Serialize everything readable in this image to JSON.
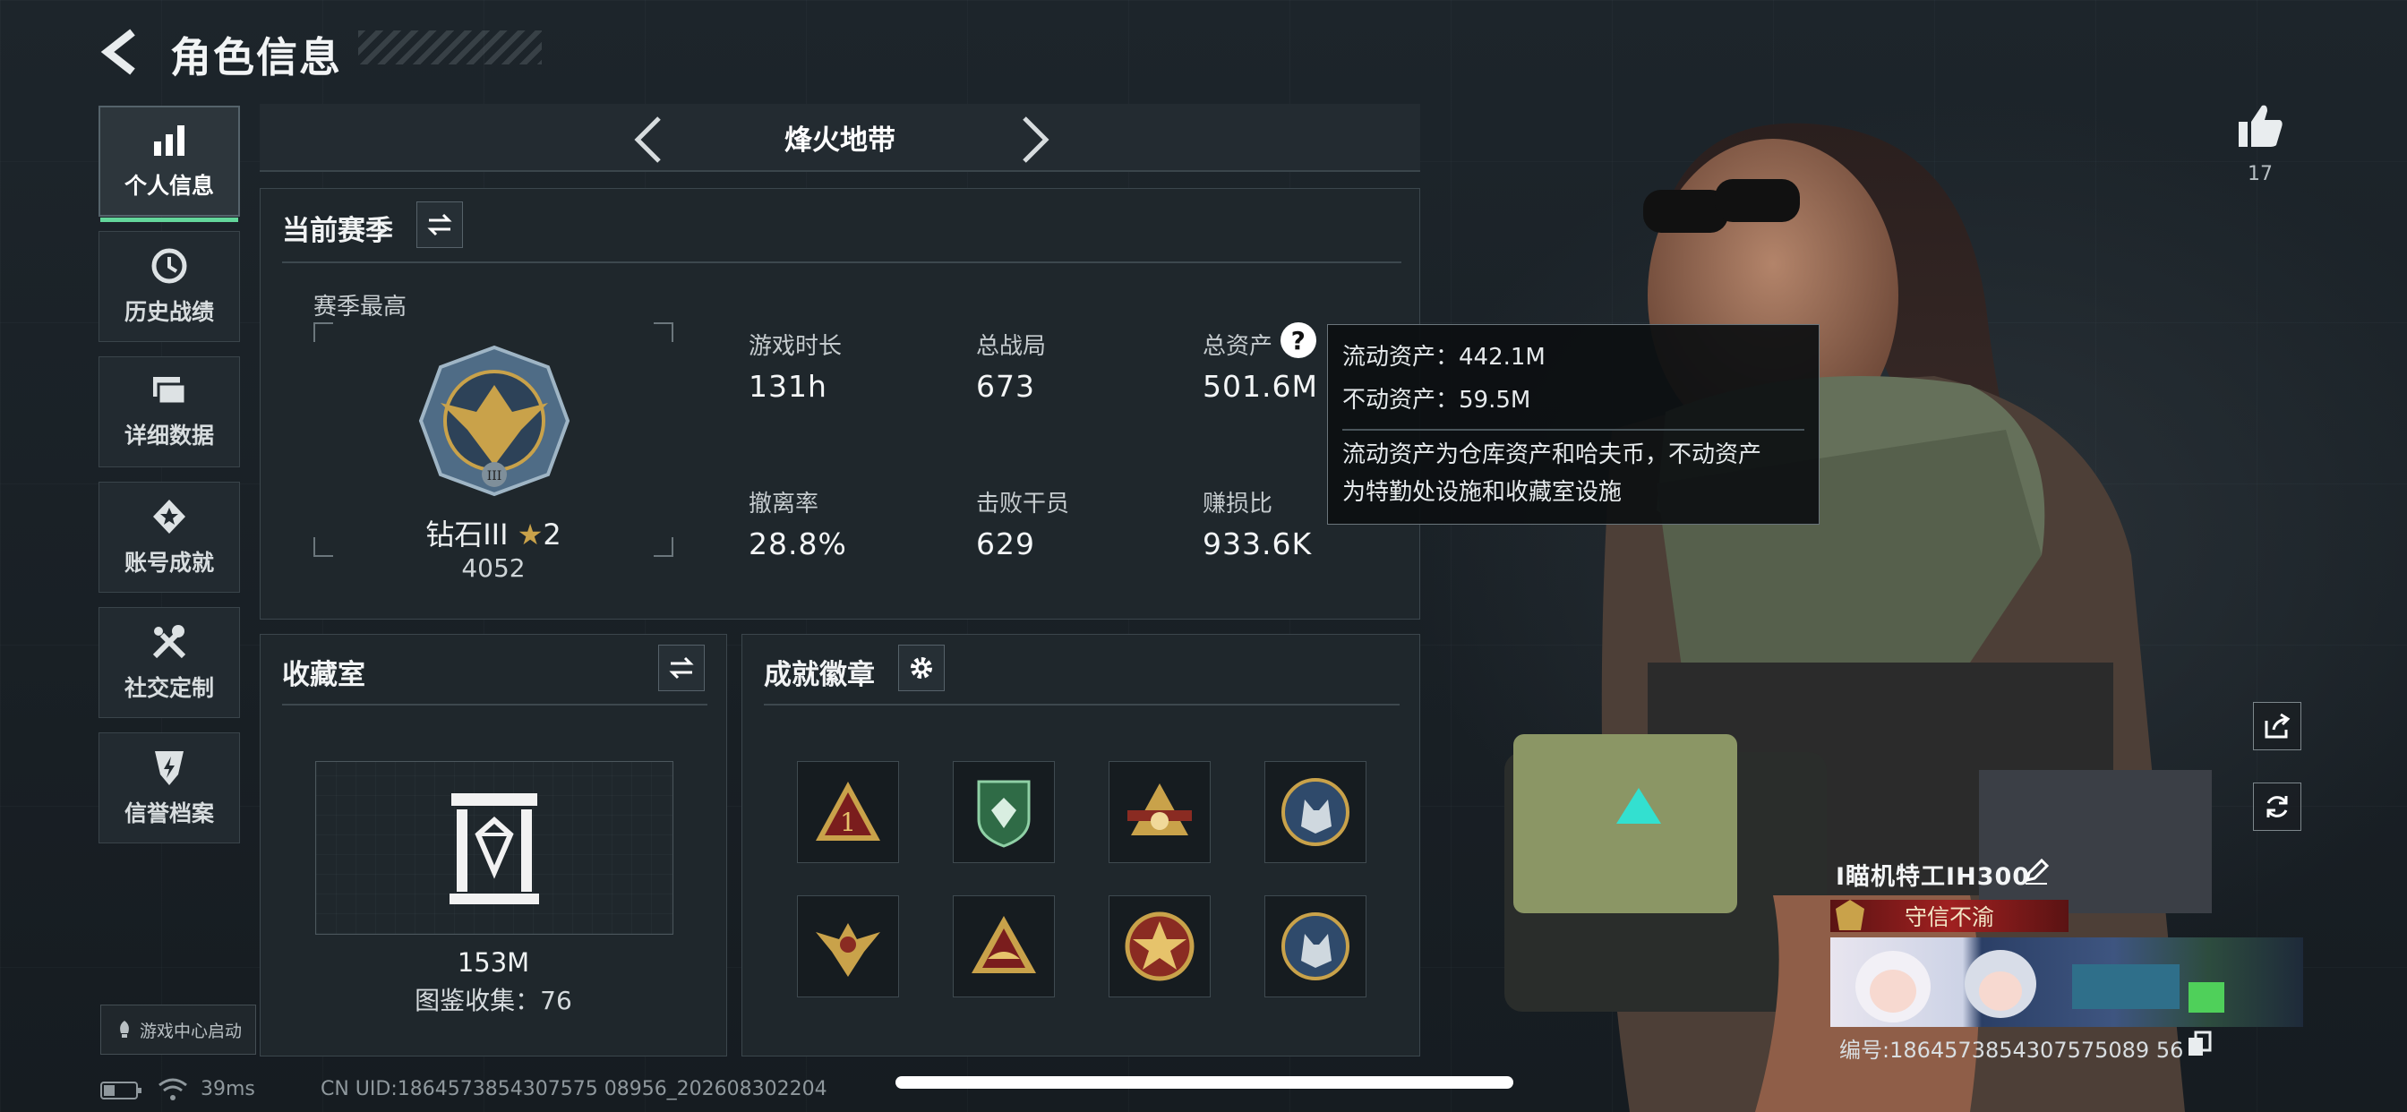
{
  "header": {
    "title": "角色信息"
  },
  "sidebar": {
    "items": [
      {
        "label": "个人信息",
        "icon": "bar-chart-icon",
        "active": true
      },
      {
        "label": "历史战绩",
        "icon": "clock-history-icon"
      },
      {
        "label": "详细数据",
        "icon": "folder-icon"
      },
      {
        "label": "账号成就",
        "icon": "medal-star-icon"
      },
      {
        "label": "社交定制",
        "icon": "tools-icon"
      },
      {
        "label": "信誉档案",
        "icon": "shield-lightning-icon"
      }
    ],
    "launch_label": "游戏中心启动"
  },
  "mode": {
    "title": "烽火地带"
  },
  "season": {
    "title": "当前赛季",
    "best_label": "赛季最高",
    "rank": "钻石III",
    "rank_stars": "2",
    "rank_score": "4052",
    "stats": [
      {
        "label": "游戏时长",
        "value": "131h"
      },
      {
        "label": "总战局",
        "value": "673"
      },
      {
        "label": "总资产",
        "value": "501.6M"
      },
      {
        "label": "撤离率",
        "value": "28.8%"
      },
      {
        "label": "击败干员",
        "value": "629"
      },
      {
        "label": "赚损比",
        "value": "933.6K"
      }
    ]
  },
  "tooltip": {
    "line1": "流动资产：442.1M",
    "line2": "不动资产：59.5M",
    "note_line1": "流动资产为仓库资产和哈夫币，不动资产",
    "note_line2": "为特勤处设施和收藏室设施"
  },
  "collection": {
    "title": "收藏室",
    "value": "153M",
    "catalog": "图鉴收集：76"
  },
  "achievements": {
    "title": "成就徽章",
    "badges": [
      {
        "icon": "triangle-one-badge-icon"
      },
      {
        "icon": "green-shield-badge-icon"
      },
      {
        "icon": "pyramid-crest-badge-icon"
      },
      {
        "icon": "wolf-coin-badge-icon"
      },
      {
        "icon": "eagle-crest-badge-icon"
      },
      {
        "icon": "hat-triangle-badge-icon"
      },
      {
        "icon": "star-medal-badge-icon"
      },
      {
        "icon": "wolf-coin-badge-icon"
      }
    ]
  },
  "profile": {
    "likes": "17",
    "name": "I瞄机特工IH300",
    "honor": "守信不渝",
    "id": "编号:1864573854307575089 56"
  },
  "footer": {
    "ping": "39ms",
    "uid": "CN UID:1864573854307575 08956_202608302204"
  },
  "colors": {
    "accent_green": "#63d69b",
    "honor_red": "#8c1f1f",
    "gold": "#c9a24a"
  }
}
